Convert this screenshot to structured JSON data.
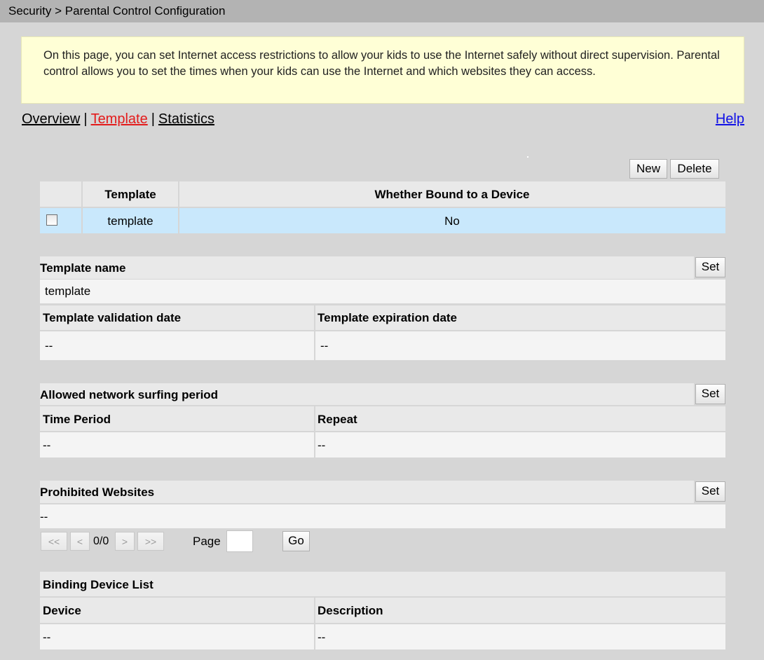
{
  "breadcrumb": "Security > Parental Control Configuration",
  "info_text": "On this page, you can set Internet access restrictions to allow your kids to use the Internet safely without direct supervision. Parental control allows you to set the times when your kids can use the Internet and which websites they can access.",
  "nav": {
    "overview": "Overview",
    "template": "Template",
    "statistics": "Statistics",
    "separator": "|",
    "help": "Help"
  },
  "toolbar": {
    "new_label": "New",
    "delete_label": "Delete"
  },
  "template_table": {
    "col_template": "Template",
    "col_bound": "Whether Bound to a Device",
    "rows": [
      {
        "template": "template",
        "bound": "No"
      }
    ]
  },
  "template_name": {
    "header": "Template name",
    "set": "Set",
    "value": "template"
  },
  "dates": {
    "validation_header": "Template validation date",
    "expiration_header": "Template expiration date",
    "validation_value": "--",
    "expiration_value": "--"
  },
  "surfing": {
    "header": "Allowed network surfing period",
    "set": "Set",
    "col_period": "Time Period",
    "col_repeat": "Repeat",
    "period_value": "--",
    "repeat_value": "--"
  },
  "websites": {
    "header": "Prohibited Websites",
    "set": "Set",
    "value": "--"
  },
  "pager": {
    "first": "<<",
    "prev": "<",
    "count": "0/0",
    "next": ">",
    "last": ">>",
    "page_label": "Page",
    "page_value": "",
    "go": "Go"
  },
  "binding": {
    "header": "Binding Device List",
    "col_device": "Device",
    "col_description": "Description",
    "device_value": "--",
    "description_value": "--"
  },
  "colors": {
    "active_tab": "#e31b1b",
    "help_link": "#1010e6",
    "selected_row": "#c9e8fc",
    "info_bg": "#ffffd6"
  }
}
